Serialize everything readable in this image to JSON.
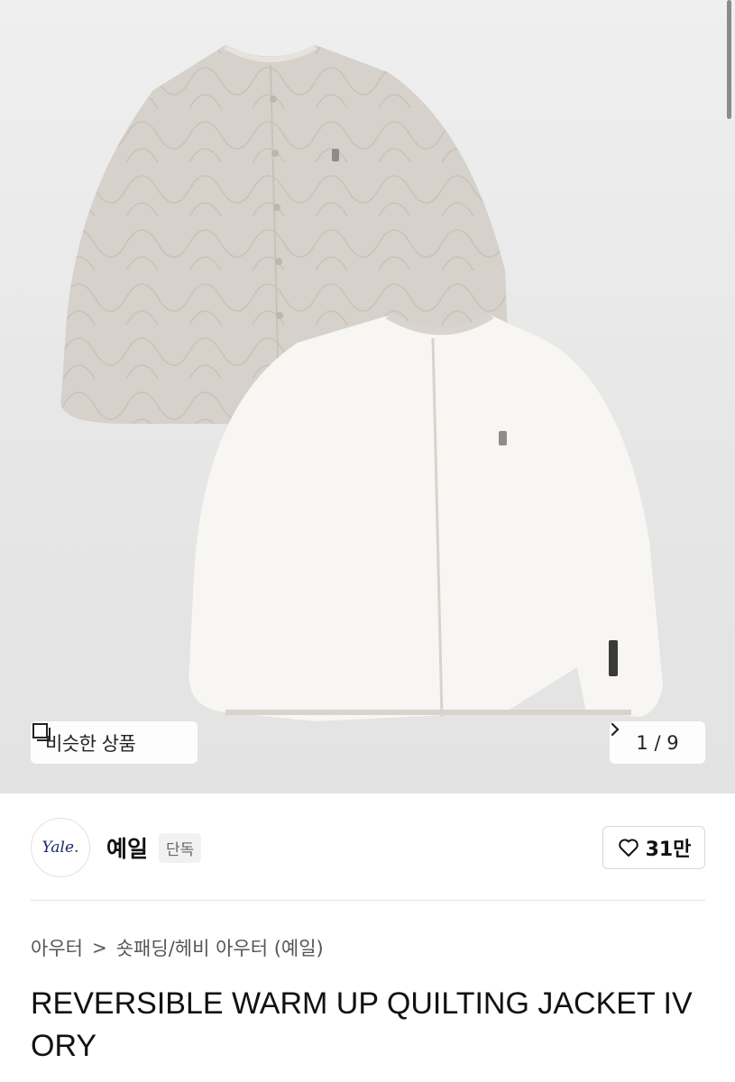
{
  "gallery": {
    "similar_label": "비슷한 상품",
    "similar_icon": "similar-products-icon",
    "page_current": "1",
    "page_separator": "/",
    "page_total": "9",
    "chevron_icon": "chevron-right-icon"
  },
  "brand": {
    "logo_text": "Yale.",
    "name": "예일",
    "badge": "단독",
    "like_icon": "heart-icon",
    "like_count": "31만"
  },
  "breadcrumb": {
    "category": "아우터",
    "separator": ">",
    "subcategory": "숏패딩/헤비 아우터 (예일)"
  },
  "product": {
    "title": "REVERSIBLE WARM UP QUILTING JACKET IVORY"
  },
  "colors": {
    "hero_bg": "#e6e6e6",
    "jacket_back": "#d6d1cb",
    "jacket_front": "#f7f6f2",
    "logo_text": "#1b2a6b"
  }
}
